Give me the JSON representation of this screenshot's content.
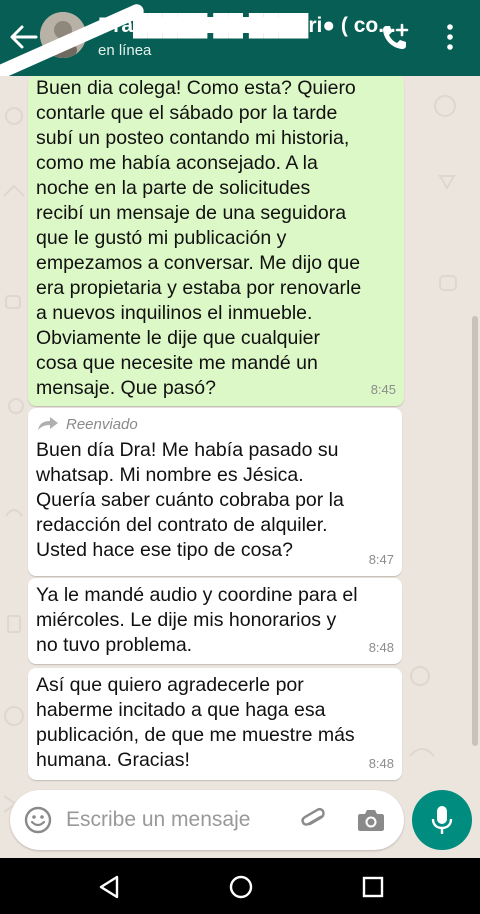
{
  "header": {
    "contact_name": "Dra█████ ██ ████ri● ( co...",
    "status": "en línea",
    "colors": {
      "bar": "#075e54",
      "accent": "#008c7e"
    },
    "icons": [
      "back-arrow-icon",
      "add-call-icon",
      "more-vert-icon"
    ]
  },
  "messages": [
    {
      "direction": "outgoing",
      "text": "Buen dia colega! Como esta? Quiero\ncontarle que el sábado por la tarde\nsubí un posteo contando mi historia,\ncomo me había aconsejado. A la\nnoche en la parte de solicitudes\nrecibí un mensaje de una seguidora\nque le gustó mi publicación y\nempezamos a conversar. Me dijo que\nera propietaria y estaba por renovarle\na nuevos inquilinos el inmueble.\nObviamente le dije que cualquier\ncosa que necesite me mandé un\nmensaje. Que pasó?",
      "time": "8:45"
    },
    {
      "direction": "incoming",
      "forwarded_label": "Reenviado",
      "text": "Buen día Dra! Me había pasado su\nwhatsap. Mi nombre es Jésica.\nQuería saber cuánto cobraba por la\nredacción del contrato de alquiler.\nUsted hace ese tipo de cosa?",
      "time": "8:47"
    },
    {
      "direction": "incoming",
      "text": "Ya le mandé audio y coordine para el\nmiércoles.  Le dije mis honorarios y\nno tuvo problema.",
      "time": "8:48"
    },
    {
      "direction": "incoming",
      "text": "Así que quiero agradecerle por\nhaberme  incitado a que haga esa\npublicación, de que me muestre más\nhumana. Gracias!",
      "time": "8:48"
    }
  ],
  "composer": {
    "placeholder": "Escribe un mensaje",
    "icons": [
      "emoji-icon",
      "attach-icon",
      "camera-icon",
      "mic-icon"
    ]
  },
  "navbar": {
    "icons": [
      "nav-back-icon",
      "nav-home-icon",
      "nav-recents-icon"
    ]
  }
}
